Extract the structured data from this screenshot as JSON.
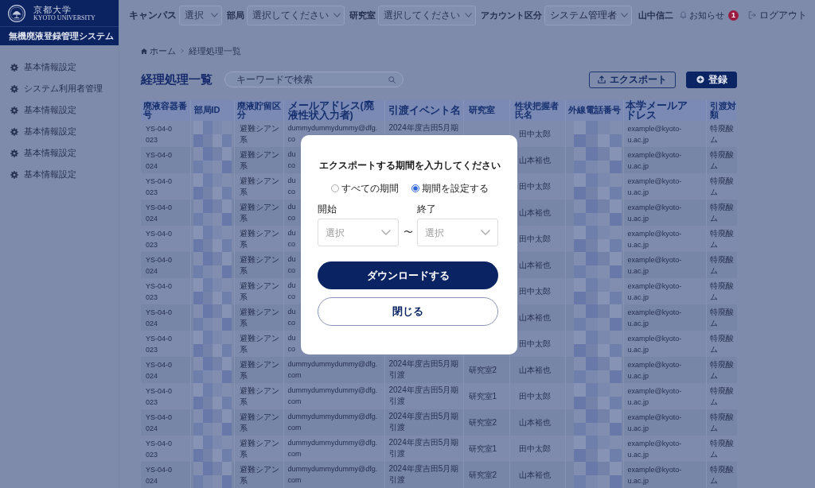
{
  "header": {
    "logo": {
      "name_ja": "京都大学",
      "name_en": "KYOTO UNIVERSITY"
    },
    "system_name": "無機廃液登録管理システム"
  },
  "top_bar": {
    "filters": [
      {
        "label": "キャンパス",
        "placeholder": "選択"
      },
      {
        "label": "部局",
        "placeholder": "選択してください"
      },
      {
        "label": "研究室",
        "placeholder": "選択してください"
      },
      {
        "label": "アカウント区分",
        "value": "システム管理者"
      }
    ],
    "user_name": "山中信二",
    "notifications": {
      "label": "お知らせ",
      "badge": "1"
    },
    "logout": "ログアウト"
  },
  "sidebar": {
    "items": [
      {
        "label": "基本情報設定"
      },
      {
        "label": "システム利用者管理"
      },
      {
        "label": "基本情報設定"
      },
      {
        "label": "基本情報設定"
      },
      {
        "label": "基本情報設定"
      },
      {
        "label": "基本情報設定"
      }
    ]
  },
  "breadcrumb": [
    {
      "kind": "home",
      "label": "ホーム"
    },
    {
      "kind": "page",
      "label": "経理処理一覧"
    }
  ],
  "page_title": "経理処理一覧",
  "search": {
    "placeholder": "キーワードで検索"
  },
  "actions": [
    {
      "kind": "export",
      "label": "エクスポート"
    },
    {
      "kind": "create",
      "label": "登録"
    }
  ],
  "table": {
    "columns": [
      {
        "label": "廃液容器番号",
        "kind": "text"
      },
      {
        "label": "部局ID",
        "kind": "redacted"
      },
      {
        "label": "廃液貯留区分",
        "kind": "text"
      },
      {
        "label": "メールアドレス(廃液性状入力者)",
        "kind": "text"
      },
      {
        "label": "引渡イベント名",
        "kind": "text"
      },
      {
        "label": "研究室",
        "kind": "text"
      },
      {
        "label": "性状把握者氏名",
        "kind": "text"
      },
      {
        "label": "外線電話番号",
        "kind": "redacted"
      },
      {
        "label": "本学メールアドレス",
        "kind": "text"
      },
      {
        "label": "引渡対類",
        "kind": "text"
      }
    ],
    "rows": [
      {
        "container_no": "YS-04-0023",
        "storage_type": "避難シアン系",
        "email": "dummydummydummy@dfg.\nco",
        "event": "2024年度吉田5月期",
        "name": "田中太郎",
        "univ_email": "example@kyoto-u.ac.jp",
        "category": "特廃酸ム"
      },
      {
        "container_no": "YS-04-0024",
        "storage_type": "避難シアン系",
        "email": "du\nco",
        "name": "山本裕也",
        "univ_email": "example@kyoto-u.ac.jp",
        "category": "特廃酸ム"
      },
      {
        "container_no": "YS-04-0023",
        "storage_type": "避難シアン系",
        "email": "du\nco",
        "name": "田中太郎",
        "univ_email": "example@kyoto-u.ac.jp",
        "category": "特廃酸ム"
      },
      {
        "container_no": "YS-04-0024",
        "storage_type": "避難シアン系",
        "email": "du\nco",
        "name": "山本裕也",
        "univ_email": "example@kyoto-u.ac.jp",
        "category": "特廃酸ム"
      },
      {
        "container_no": "YS-04-0023",
        "storage_type": "避難シアン系",
        "email": "du\nco",
        "name": "田中太郎",
        "univ_email": "example@kyoto-u.ac.jp",
        "category": "特廃酸ム"
      },
      {
        "container_no": "YS-04-0024",
        "storage_type": "避難シアン系",
        "email": "du\nco",
        "name": "山本裕也",
        "univ_email": "example@kyoto-u.ac.jp",
        "category": "特廃酸ム"
      },
      {
        "container_no": "YS-04-0023",
        "storage_type": "避難シアン系",
        "email": "du\nco",
        "name": "田中太郎",
        "univ_email": "example@kyoto-u.ac.jp",
        "category": "特廃酸ム"
      },
      {
        "container_no": "YS-04-0024",
        "storage_type": "避難シアン系",
        "email": "du\nco",
        "name": "山本裕也",
        "univ_email": "example@kyoto-u.ac.jp",
        "category": "特廃酸ム"
      },
      {
        "container_no": "YS-04-0023",
        "storage_type": "避難シアン系",
        "email": "du\nco",
        "name": "田中太郎",
        "univ_email": "example@kyoto-u.ac.jp",
        "category": "特廃酸ム"
      },
      {
        "container_no": "YS-04-0024",
        "storage_type": "避難シアン系",
        "email": "dummydummydummy@dfg.com",
        "event": "2024年度吉田5月期引渡",
        "lab": "研究室2",
        "name": "山本裕也",
        "univ_email": "example@kyoto-u.ac.jp",
        "category": "特廃酸ム"
      },
      {
        "container_no": "YS-04-0023",
        "storage_type": "避難シアン系",
        "email": "dummydummydummy@dfg.com",
        "event": "2024年度吉田5月期引渡",
        "lab": "研究室1",
        "name": "田中太郎",
        "univ_email": "example@kyoto-u.ac.jp",
        "category": "特廃酸ム"
      },
      {
        "container_no": "YS-04-0024",
        "storage_type": "避難シアン系",
        "email": "dummydummydummy@dfg.com",
        "event": "2024年度吉田5月期引渡",
        "lab": "研究室2",
        "name": "山本裕也",
        "univ_email": "example@kyoto-u.ac.jp",
        "category": "特廃酸ム"
      },
      {
        "container_no": "YS-04-0023",
        "storage_type": "避難シアン系",
        "email": "dummydummydummy@dfg.com",
        "event": "2024年度吉田5月期引渡",
        "lab": "研究室1",
        "name": "田中太郎",
        "univ_email": "example@kyoto-u.ac.jp",
        "category": "特廃酸ム"
      },
      {
        "container_no": "YS-04-0024",
        "storage_type": "避難シアン系",
        "email": "dummydummydummy@dfg.com",
        "event": "2024年度吉田5月期引渡",
        "lab": "研究室2",
        "name": "山本裕也",
        "univ_email": "example@kyoto-u.ac.jp",
        "category": "特廃酸ム"
      }
    ]
  },
  "modal": {
    "title": "エクスポートする期間を入力してください",
    "options": [
      {
        "label": "すべての期間",
        "selected": false
      },
      {
        "label": "期間を設定する",
        "selected": true
      }
    ],
    "range": {
      "fields": [
        {
          "label": "開始",
          "placeholder": "選択"
        },
        {
          "label": "終了",
          "placeholder": "選択"
        }
      ],
      "separator": "〜"
    },
    "buttons": [
      {
        "kind": "primary",
        "label": "ダウンロードする"
      },
      {
        "kind": "secondary",
        "label": "閉じる"
      }
    ]
  }
}
